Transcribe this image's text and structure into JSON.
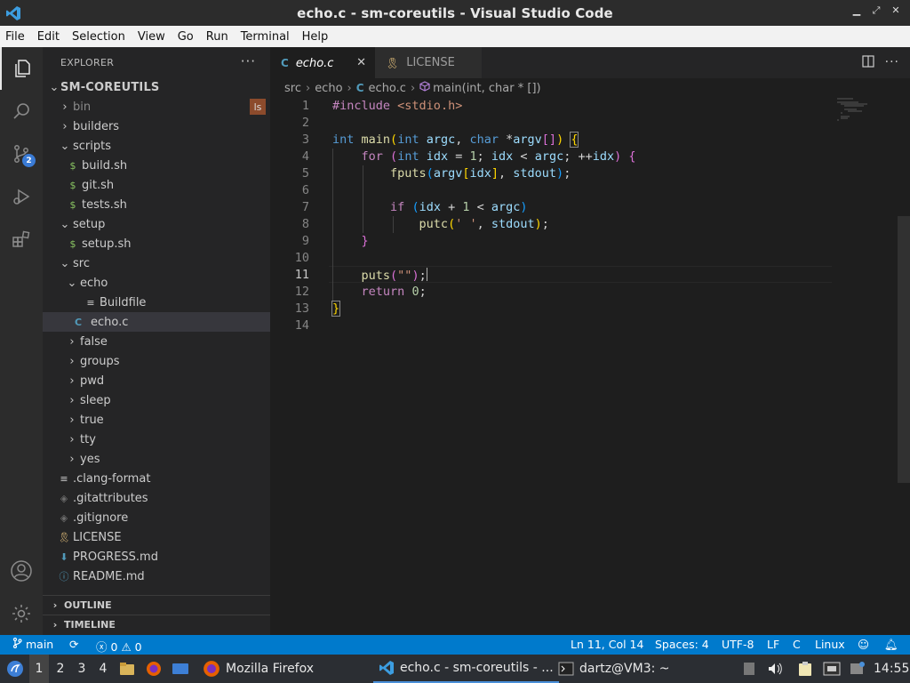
{
  "window": {
    "title": "echo.c - sm-coreutils - Visual Studio Code"
  },
  "menu": [
    "File",
    "Edit",
    "Selection",
    "View",
    "Go",
    "Run",
    "Terminal",
    "Help"
  ],
  "activity": {
    "source_control_badge": "2"
  },
  "explorer": {
    "header": "EXPLORER",
    "more": "···",
    "root": "SM-COREUTILS",
    "ls_badge": "ls",
    "items": [
      {
        "label": "bin"
      },
      {
        "label": "builders"
      },
      {
        "label": "scripts"
      },
      {
        "label": "build.sh"
      },
      {
        "label": "git.sh"
      },
      {
        "label": "tests.sh"
      },
      {
        "label": "setup"
      },
      {
        "label": "setup.sh"
      },
      {
        "label": "src"
      },
      {
        "label": "echo"
      },
      {
        "label": "Buildfile"
      },
      {
        "label": "echo.c"
      },
      {
        "label": "false"
      },
      {
        "label": "groups"
      },
      {
        "label": "pwd"
      },
      {
        "label": "sleep"
      },
      {
        "label": "true"
      },
      {
        "label": "tty"
      },
      {
        "label": "yes"
      },
      {
        "label": ".clang-format"
      },
      {
        "label": ".gitattributes"
      },
      {
        "label": ".gitignore"
      },
      {
        "label": "LICENSE"
      },
      {
        "label": "PROGRESS.md"
      },
      {
        "label": "README.md"
      }
    ],
    "outline": "OUTLINE",
    "timeline": "TIMELINE"
  },
  "tabs": [
    {
      "label": "echo.c",
      "icon": "C"
    },
    {
      "label": "LICENSE"
    }
  ],
  "breadcrumbs": {
    "src": "src",
    "echo": "echo",
    "file": "echo.c",
    "file_icon": "C",
    "symbol": "main(int, char * [])"
  },
  "editor": {
    "line_numbers": [
      "1",
      "2",
      "3",
      "4",
      "5",
      "6",
      "7",
      "8",
      "9",
      "10",
      "11",
      "12",
      "13",
      "14"
    ],
    "current_line": "11"
  },
  "status": {
    "branch": "main",
    "errors": "0",
    "warnings": "0",
    "cursor": "Ln 11, Col 14",
    "indent": "Spaces: 4",
    "encoding": "UTF-8",
    "eol": "LF",
    "language": "C",
    "os": "Linux"
  },
  "taskbar": {
    "workspaces": [
      "1",
      "2",
      "3",
      "4"
    ],
    "firefox": "Mozilla Firefox",
    "vscode": "echo.c - sm-coreutils - ...",
    "terminal": "dartz@VM3: ~",
    "clock": "14:55"
  },
  "colors": {
    "accent": "#007acc",
    "sidebar": "#252526",
    "editor": "#1e1e1e"
  }
}
